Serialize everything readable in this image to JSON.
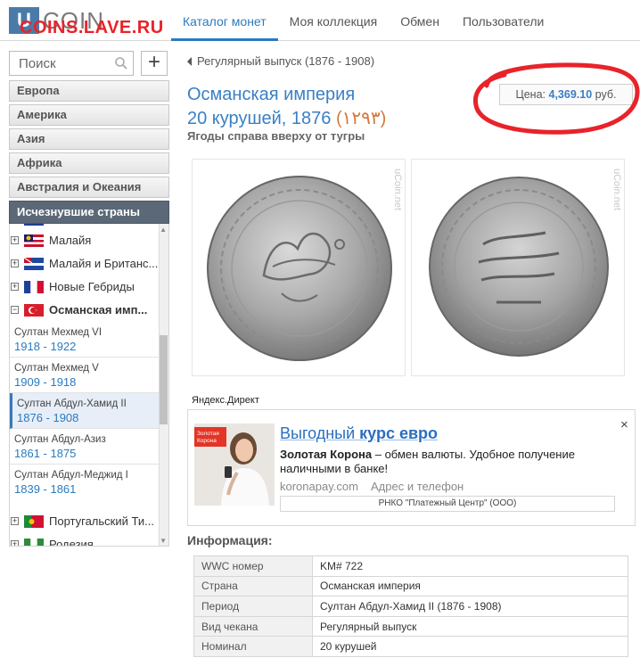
{
  "header": {
    "logo_mark": "U",
    "logo_text": "COIN",
    "watermark": "COINS.LAVE.RU",
    "nav": [
      {
        "label": "Каталог монет",
        "active": true
      },
      {
        "label": "Моя коллекция",
        "active": false
      },
      {
        "label": "Обмен",
        "active": false
      },
      {
        "label": "Пользователи",
        "active": false
      }
    ]
  },
  "sidebar": {
    "search_placeholder": "Поиск",
    "add_label": "+",
    "regions": [
      "Европа",
      "Америка",
      "Азия",
      "Африка",
      "Австралия и Океания",
      "Исчезнувшие страны"
    ],
    "active_region": "Исчезнувшие страны",
    "countries_top": [
      {
        "name": "Малайя",
        "expander": "+",
        "flag": "malaya"
      },
      {
        "name": "Малайя и Британс...",
        "expander": "+",
        "flag": "malaya-borneo"
      },
      {
        "name": "Новые Гебриды",
        "expander": "+",
        "flag": "new-hebrides"
      },
      {
        "name": "Османская имп...",
        "expander": "−",
        "flag": "ottoman",
        "expanded": true
      }
    ],
    "rulers": [
      {
        "name": "Султан Мехмед VI",
        "years": "1918 - 1922",
        "selected": false
      },
      {
        "name": "Султан Мехмед V",
        "years": "1909 - 1918",
        "selected": false
      },
      {
        "name": "Султан Абдул-Хамид II",
        "years": "1876 - 1908",
        "selected": true
      },
      {
        "name": "Султан Абдул-Азиз",
        "years": "1861 - 1875",
        "selected": false
      },
      {
        "name": "Султан Абдул-Меджид I",
        "years": "1839 - 1861",
        "selected": false
      }
    ],
    "countries_bottom": [
      {
        "name": "Португальский Ти...",
        "expander": "+",
        "flag": "portuguese-timor"
      },
      {
        "name": "Родезия",
        "expander": "+",
        "flag": "rhodesia"
      }
    ]
  },
  "main": {
    "breadcrumb": "Регулярный выпуск  (1876 - 1908)",
    "title_country": "Османская империя",
    "title_coin": "20 курушей, 1876",
    "title_alt_date": "(١٢٩٣)",
    "subtitle": "Ягоды справа вверху от тугры",
    "price_label": "Цена:",
    "price_value": "4,369.10",
    "price_currency": "руб.",
    "coin_watermark": "uCoin.net"
  },
  "ad": {
    "label": "Яндекс.Директ",
    "title_plain": "Выгодный ",
    "title_bold": "курс евро",
    "text_bold": "Золотая Корона",
    "text_rest": " – обмен валюты. Удобное получение наличными в банке!",
    "domain": "koronapay.com",
    "address": "Адрес и телефон",
    "org": "РНКО \"Платежный Центр\" (ООО)",
    "brand_line1": "Золотая",
    "brand_line2": "Корона",
    "close": "×"
  },
  "info": {
    "heading": "Информация:",
    "rows": [
      {
        "key": "WWC номер",
        "value": "KM# 722"
      },
      {
        "key": "Страна",
        "value": "Османская империя"
      },
      {
        "key": "Период",
        "value": "Султан Абдул-Хамид II (1876 - 1908)"
      },
      {
        "key": "Вид чекана",
        "value": "Регулярный выпуск"
      },
      {
        "key": "Номинал",
        "value": "20 курушей"
      }
    ]
  },
  "colors": {
    "accent": "#2a7bbf",
    "annotation": "#e8232a",
    "active_region": "#5b6878"
  }
}
